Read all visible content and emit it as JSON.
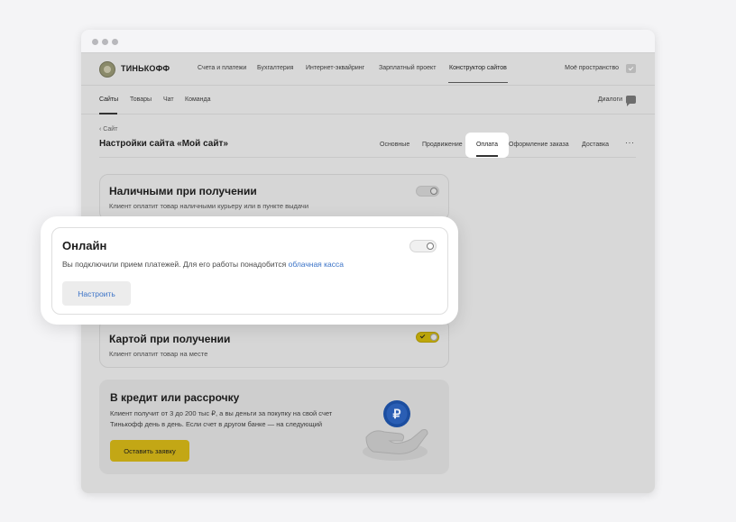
{
  "brand": {
    "name": "ТИНЬКОФФ"
  },
  "main_nav": {
    "items": [
      "Счета и платежи",
      "Бухгалтерия",
      "Интернет-эквайринг",
      "Зарплатный проект",
      "Конструктор сайтов"
    ],
    "active": "Конструктор сайтов",
    "workspace_label": "Моё пространство"
  },
  "sub_nav": {
    "items": [
      "Сайты",
      "Товары",
      "Чат",
      "Команда"
    ],
    "active": "Сайты",
    "dialogs_label": "Диалоги"
  },
  "page": {
    "back_label": "Сайт",
    "title": "Настройки сайта «Мой сайт»",
    "tabs": [
      "Основные",
      "Продвижение",
      "Оплата",
      "Оформление заказа",
      "Доставка"
    ],
    "active_tab": "Оплата",
    "more_label": "···"
  },
  "payments": {
    "cash": {
      "title": "Наличными при получении",
      "description": "Клиент оплатит товар наличными курьеру или в пункте выдачи",
      "enabled": false
    },
    "online": {
      "title": "Онлайн",
      "description": "Вы подключили прием платежей. Для его работы понадобится",
      "link_text": "облачная касса",
      "button_label": "Настроить",
      "enabled": false
    },
    "card": {
      "title": "Картой при получении",
      "description": "Клиент оплатит товар на месте",
      "enabled": true
    }
  },
  "credit": {
    "title": "В кредит или рассрочку",
    "description": "Клиент получит от 3 до 200 тыс ₽, а вы деньги за покупку на свой счет Тинькофф день в день. Если счет в другом банке — на следующий",
    "button_label": "Оставить заявку",
    "coin_symbol": "₽"
  },
  "colors": {
    "accent_yellow": "#ffdd2d",
    "link_blue": "#3b73c7",
    "coin_blue": "#1c4ea0"
  }
}
